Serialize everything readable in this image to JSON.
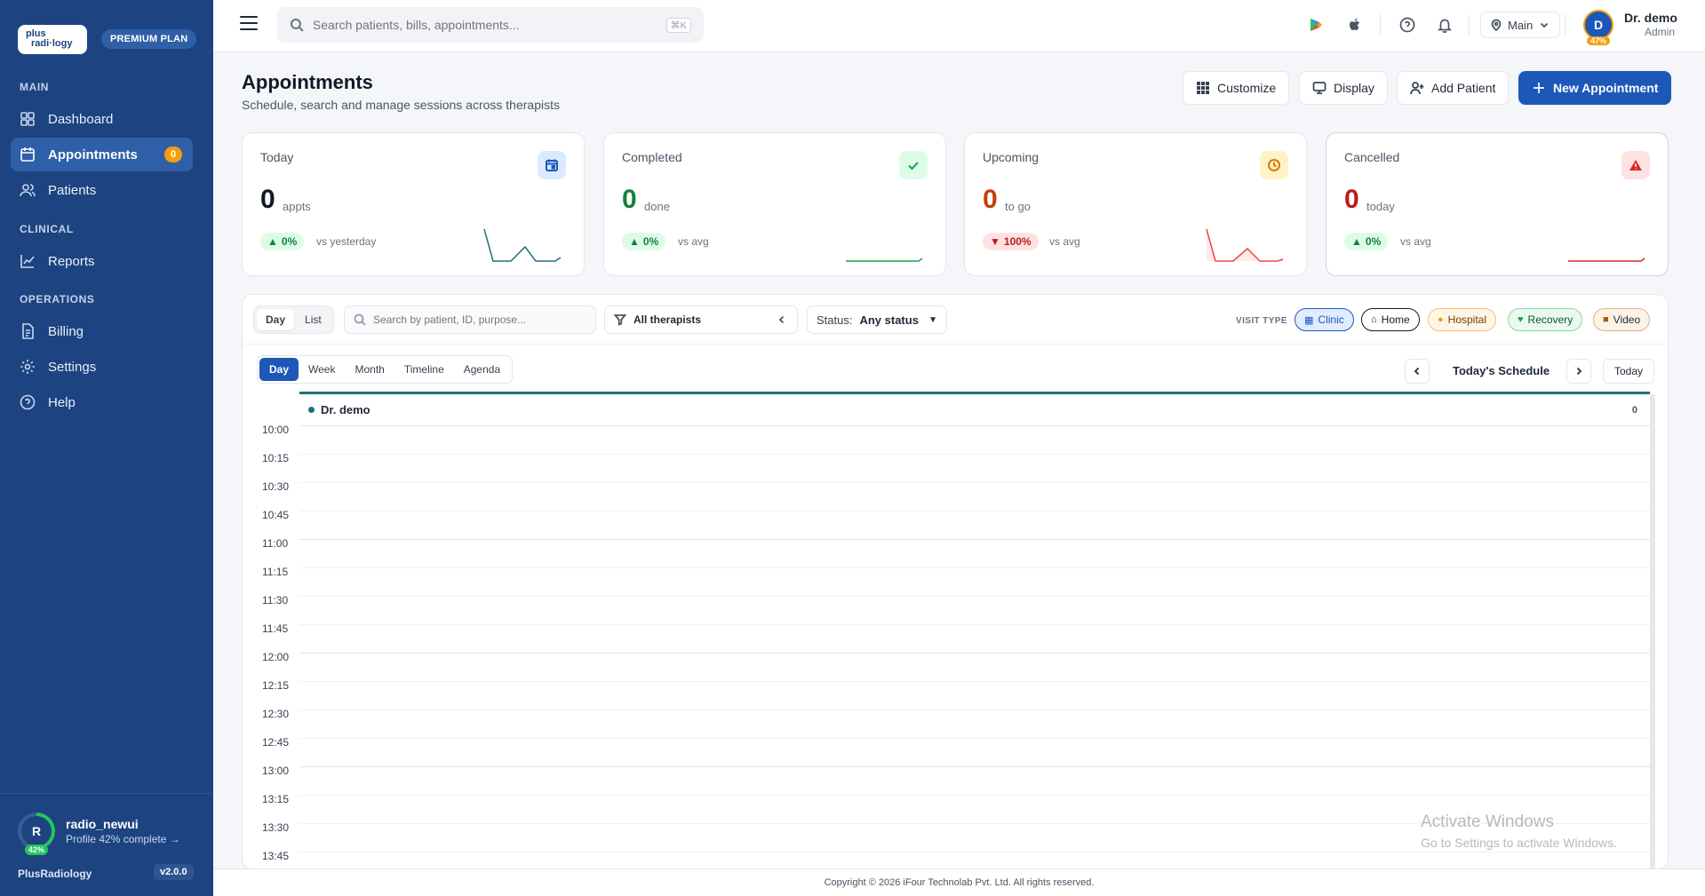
{
  "sidebar": {
    "logo_line1": "plus",
    "logo_line2": "radi·logy",
    "plan": "PREMIUM PLAN",
    "sections": [
      "MAIN",
      "CLINICAL",
      "OPERATIONS"
    ],
    "items": [
      {
        "label": "Dashboard"
      },
      {
        "label": "Appointments",
        "badge": "0"
      },
      {
        "label": "Patients"
      },
      {
        "label": "Reports"
      },
      {
        "label": "Billing"
      },
      {
        "label": "Settings"
      },
      {
        "label": "Help"
      }
    ],
    "profile": {
      "initial": "R",
      "name": "radio_newui",
      "sub": "Profile 42% complete →",
      "pct": "42%",
      "progress": 0.42
    },
    "brand": "PlusRadiology",
    "version": "v2.0.0"
  },
  "topbar": {
    "search_placeholder": "Search patients, bills, appointments...",
    "shortcut": "⌘K",
    "location": "Main",
    "user_initial": "D",
    "user_pct": "47%",
    "user_name": "Dr. demo",
    "user_role": "Admin"
  },
  "header": {
    "title": "Appointments",
    "subtitle": "Schedule, search and manage sessions across therapists",
    "buttons": {
      "customize": "Customize",
      "display": "Display",
      "add_patient": "Add Patient",
      "new_appointment": "New Appointment"
    }
  },
  "stats": [
    {
      "title": "Today",
      "value": "0",
      "unit": "appts",
      "delta": "0%",
      "vs": "vs yesterday",
      "color": "#111827",
      "accent": "#1f6f7a"
    },
    {
      "title": "Completed",
      "value": "0",
      "unit": "done",
      "delta": "0%",
      "vs": "vs avg",
      "color": "#15803d",
      "accent": "#16a34a"
    },
    {
      "title": "Upcoming",
      "value": "0",
      "unit": "to go",
      "delta": "100%",
      "vs": "vs avg",
      "color": "#c2410c",
      "accent": "#ef4444"
    },
    {
      "title": "Cancelled",
      "value": "0",
      "unit": "today",
      "delta": "0%",
      "vs": "vs avg",
      "color": "#b91c1c",
      "accent": "#dc2626"
    }
  ],
  "filters": {
    "mode_tabs": [
      "Day",
      "List"
    ],
    "search_placeholder": "Search by patient, ID, purpose...",
    "therapist": "All therapists",
    "status_label": "Status:",
    "status_value": "Any status",
    "visit_type_label": "VISIT TYPE",
    "visit_types": [
      "Clinic",
      "Home",
      "Hospital",
      "Recovery",
      "Video"
    ]
  },
  "calendar": {
    "views": [
      "Day",
      "Week",
      "Month",
      "Timeline",
      "Agenda"
    ],
    "label": "Today's Schedule",
    "today": "Today",
    "therapist": "Dr. demo",
    "count": "0",
    "times": [
      "10:00",
      "10:15",
      "10:30",
      "10:45",
      "11:00",
      "11:15",
      "11:30",
      "11:45",
      "12:00",
      "12:15",
      "12:30",
      "12:45",
      "13:00",
      "13:15",
      "13:30",
      "13:45"
    ]
  },
  "footer": {
    "copyright": "Copyright © 2026 iFour Technolab Pvt. Ltd. All rights reserved."
  },
  "watermark": {
    "line1": "Activate Windows",
    "line2": "Go to Settings to activate Windows."
  }
}
